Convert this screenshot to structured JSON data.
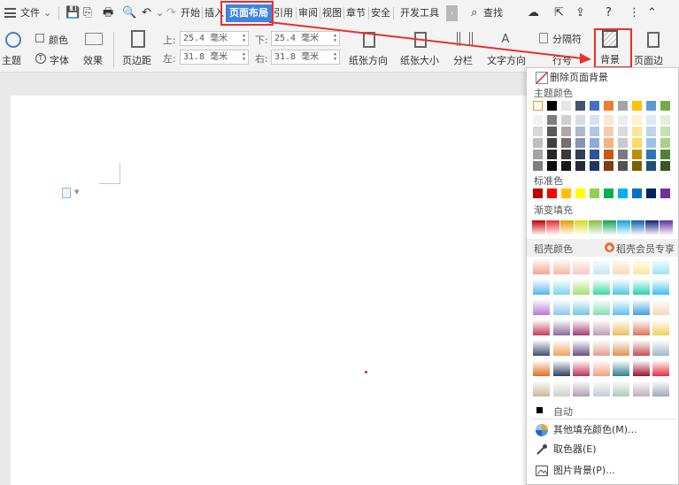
{
  "toolbar": {
    "menu_icon": "hamburger-icon",
    "file_label": "文件",
    "tabs": [
      "开始",
      "插入",
      "页面布局",
      "引用",
      "审阅",
      "视图",
      "章节",
      "安全",
      "开发工具"
    ],
    "active_tab": "页面布局",
    "search_label": "查找"
  },
  "ribbon": {
    "theme_label": "主题",
    "colors_label": "颜色",
    "fonts_label": "字体",
    "effects_label": "效果",
    "margins_label": "页边距",
    "margin_top_label": "上:",
    "margin_top_value": "25.4 毫米",
    "margin_bottom_label": "下:",
    "margin_bottom_value": "25.4 毫米",
    "margin_left_label": "左:",
    "margin_left_value": "31.8 毫米",
    "margin_right_label": "右:",
    "margin_right_value": "31.8 毫米",
    "orientation_label": "纸张方向",
    "size_label": "纸张大小",
    "columns_label": "分栏",
    "text_direction_label": "文字方向",
    "breaks_label": "分隔符",
    "line_numbers_label": "行号",
    "background_label": "背景",
    "page_border_label": "页面边"
  },
  "menu": {
    "remove_background": "删除页面背景",
    "theme_colors_title": "主题颜色",
    "standard_colors_title": "标准色",
    "gradient_fill_title": "渐变填充",
    "docer_colors_title": "稻壳颜色",
    "docer_vip_label": "稻壳会员专享",
    "auto_label": "自动",
    "more_fill_colors": "其他填充颜色(M)...",
    "eyedropper": "取色器(E)",
    "picture_background": "图片背景(P)...",
    "theme_top_row": [
      "#ffffff",
      "#000000",
      "#e7e6e6",
      "#44546a",
      "#4472c4",
      "#ed7d31",
      "#a5a5a5",
      "#ffc000",
      "#5b9bd5",
      "#70ad47"
    ],
    "theme_shades": [
      [
        "#f2f2f2",
        "#7f7f7f",
        "#d0cece",
        "#d6dce4",
        "#d9e2f3",
        "#fbe5d5",
        "#ededed",
        "#fff2cc",
        "#deeaf6",
        "#e2efd9"
      ],
      [
        "#d8d8d8",
        "#595959",
        "#aeaaaa",
        "#adb9ca",
        "#b4c6e7",
        "#f7cbac",
        "#dbdbdb",
        "#fee599",
        "#bdd6ee",
        "#c5e0b3"
      ],
      [
        "#bfbfbf",
        "#3f3f3f",
        "#757070",
        "#8496b0",
        "#8eaadb",
        "#f4b183",
        "#c9c9c9",
        "#ffd965",
        "#9cc3e5",
        "#a8d08d"
      ],
      [
        "#a5a5a5",
        "#262626",
        "#3a3838",
        "#323f4f",
        "#2f5496",
        "#c55a11",
        "#7b7b7b",
        "#bf8f00",
        "#2e75b5",
        "#538135"
      ],
      [
        "#7f7f7f",
        "#0c0c0c",
        "#171616",
        "#222a35",
        "#1e3864",
        "#833c0b",
        "#525252",
        "#7f6000",
        "#1e4e79",
        "#375623"
      ]
    ],
    "standard_colors": [
      "#c00000",
      "#ff0000",
      "#ffc000",
      "#ffff00",
      "#92d050",
      "#00b050",
      "#00b0f0",
      "#0070c0",
      "#002060",
      "#7030a0"
    ],
    "gradient_colors": [
      "#c00000",
      "#e03030",
      "#e0a000",
      "#d8d820",
      "#80c040",
      "#10a050",
      "#10a0e0",
      "#1060b0",
      "#102070",
      "#6030a0"
    ],
    "docer_gradients": [
      [
        "#f3a58c",
        "#f7b8a0",
        "#fbc3c3",
        "#c2e7f3",
        "#f8d8b8",
        "#f9e8a0",
        "#9de4f0"
      ],
      [
        "#5bb5f0",
        "#7fd6e8",
        "#a4e070",
        "#3ed8a0",
        "#53c7e0",
        "#2ed0b0",
        "#3ec0f0"
      ],
      [
        "#b87ad8",
        "#90c8e8",
        "#70c8e0",
        "#80e0b0",
        "#60c0f0",
        "#40a0e0",
        "#f4d9b8"
      ],
      [
        "#c0405a",
        "#8a6a9a",
        "#a04070",
        "#c0a0b0",
        "#e8c060",
        "#e07060",
        "#f0d060"
      ],
      [
        "#40506a",
        "#f0a060",
        "#6a5080",
        "#e0a090",
        "#e09050",
        "#c05050",
        "#a0b8c8"
      ],
      [
        "#e07020",
        "#304060",
        "#c0305a",
        "#f0a080",
        "#308090",
        "#a01030",
        "#e03040"
      ],
      [
        "#c8b898",
        "#d0d0d0",
        "#b0a0b0",
        "#c8c8d8",
        "#b0c8b8",
        "#c0b0b8",
        "#a0a8b8"
      ]
    ]
  }
}
